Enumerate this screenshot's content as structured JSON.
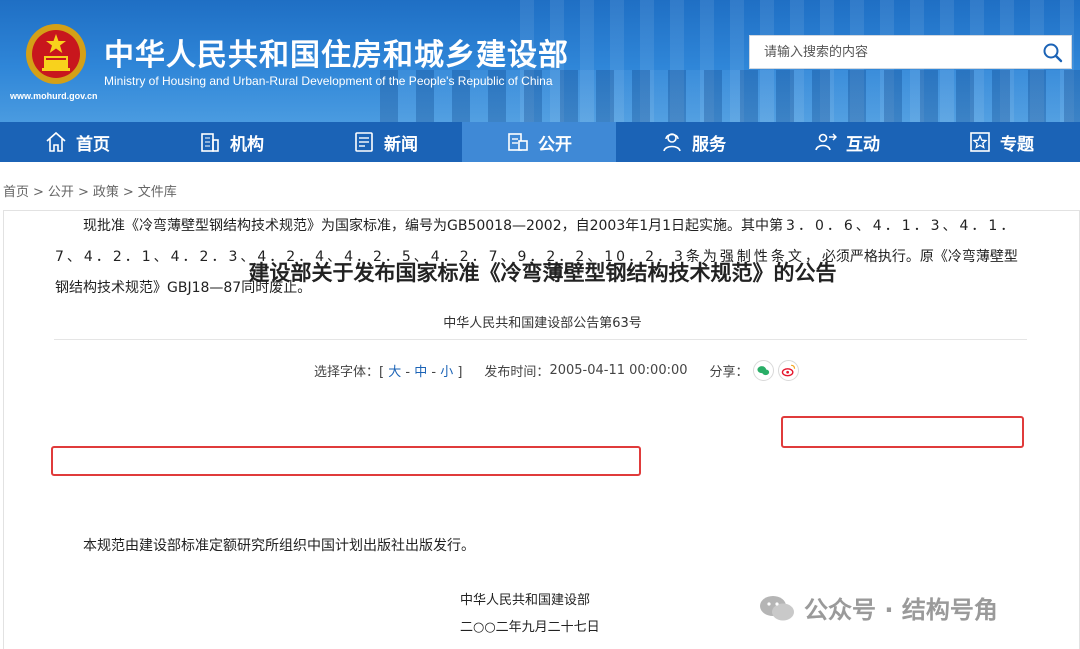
{
  "header": {
    "title": "中华人民共和国住房和城乡建设部",
    "subtitle": "Ministry of Housing and Urban-Rural Development of the People's Republic of China",
    "url": "www.mohurd.gov.cn",
    "search_placeholder": "请输入搜索的内容",
    "brand_color": "#1b63b6"
  },
  "nav": {
    "items": [
      {
        "label": "首页",
        "icon": "home-icon"
      },
      {
        "label": "机构",
        "icon": "building-icon"
      },
      {
        "label": "新闻",
        "icon": "news-icon"
      },
      {
        "label": "公开",
        "icon": "public-icon",
        "active": true
      },
      {
        "label": "服务",
        "icon": "service-icon"
      },
      {
        "label": "互动",
        "icon": "interact-icon"
      },
      {
        "label": "专题",
        "icon": "star-icon"
      }
    ]
  },
  "breadcrumb": [
    "首页",
    "公开",
    "政策",
    "文件库"
  ],
  "article": {
    "title": "建设部关于发布国家标准《冷弯薄壁型钢结构技术规范》的公告",
    "subtitle": "中华人民共和国建设部公告第63号",
    "font_size_label": "选择字体：[",
    "font_sizes": [
      "大",
      "中",
      "小"
    ],
    "font_size_close": "]",
    "publish_label": "发布时间：",
    "publish_time": "2005-04-11 00:00:00",
    "share_label": "分享：",
    "para1_a": "现批准《冷弯薄壁型钢结构技术规范》为国家标准，编号为GB50018—2002，自2003年1月1日起实施。其中",
    "para1_b": "第3．0．6、4．1．3、4．1．7、",
    "para1_c": "4．2．1、4．2．3、4．2．4、4．2．5、4．2．7、9．2．2、10．2．3条为强制性条文，",
    "para1_d": "必须严格执行。原《冷弯薄壁型钢结构技术规范》GBJ18—87同时废止。",
    "para2": "本规范由建设部标准定额研究所组织中国计划出版社出版发行。",
    "sign_org": "中华人民共和国建设部",
    "sign_date": "二○○二年九月二十七日"
  },
  "watermark": "公众号 · 结构号角",
  "highlight_color": "#e03b3b"
}
